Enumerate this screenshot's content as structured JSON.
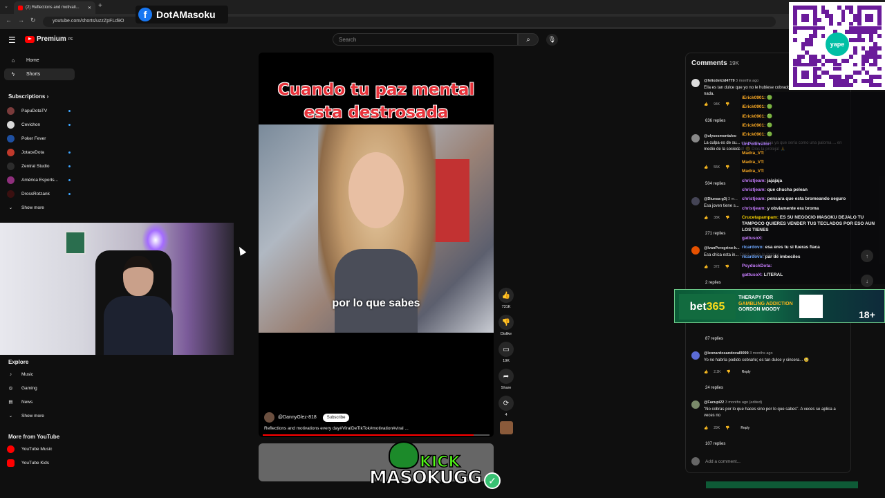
{
  "browser": {
    "tab_title": "(2) Reflections and motivati...",
    "url": "youtube.com/shorts/uzzZpFLd9O"
  },
  "overlay_fb": {
    "text": "DotAMasoku"
  },
  "header": {
    "logo": "Premium",
    "logo_sup": "PE",
    "search_placeholder": "Search"
  },
  "sidebar": {
    "home": "Home",
    "shorts": "Shorts",
    "subscriptions_title": "Subscriptions",
    "subs": [
      {
        "name": "PapuDotaTV",
        "color": "#7a3b3b"
      },
      {
        "name": "Cevichon",
        "color": "#d8d8d8"
      },
      {
        "name": "Poker Fever",
        "color": "#1e4fa0"
      },
      {
        "name": "JotaceDota",
        "color": "#c0392b"
      },
      {
        "name": "Zentral Studio",
        "color": "#2c2c2c"
      },
      {
        "name": "América Esports...",
        "color": "#8e2f7c"
      },
      {
        "name": "DrossRotzank",
        "color": "#3a1010"
      }
    ],
    "show_more": "Show more",
    "explore_title": "Explore",
    "explore": [
      "Music",
      "Gaming",
      "News"
    ],
    "explore_show_more": "Show more",
    "more_title": "More from YouTube",
    "more": [
      "YouTube Music",
      "YouTube Kids"
    ]
  },
  "video": {
    "title_line1": "Cuando tu paz mental",
    "title_line2": "esta destrosada",
    "caption": "por lo que sabes",
    "channel": "@DannyGlez-818",
    "subscribe": "Subscribe",
    "description": "Reflections and motivations every day#ViralDeTikTok#motivation#viral ...",
    "progress": 0.93
  },
  "actions": {
    "likes": "731K",
    "dislike": "Dislike",
    "comments": "19K",
    "share": "Share",
    "remix": "4"
  },
  "comments": {
    "title": "Comments",
    "count": "19K",
    "items": [
      {
        "user": "@felixdelcid4779",
        "time": "3 months ago",
        "text": "Ella es tan dulce que yo no le hubiese cobrado, a veces ayudar no cuesta nada.",
        "likes": "94K",
        "replies": "636 replies"
      },
      {
        "user": "@ulysesmontalvo",
        "time": "",
        "text": "La culpa es de su... enseñarle malicia ya que sería como una paloma ... en medio de la sociedad! 😢 Dios la proteja! 🙏",
        "likes": "55K",
        "replies": "504 replies"
      },
      {
        "user": "@Diunsa-g3j",
        "time": "3 m...",
        "text": "Esa joven tiene s...",
        "likes": "38K",
        "replies": "271 replies"
      },
      {
        "user": "@IvanPeregrino-k...",
        "time": "",
        "text": "Esa chica esta in... Ojalá nadie la lastime",
        "likes": "372",
        "replies": "2 replies"
      },
      {
        "user": "",
        "time": "",
        "text": "",
        "likes": "",
        "replies": "87 replies"
      },
      {
        "user": "@leonardosandoval9099",
        "time": "3 months ago",
        "text": "Yo no habría podido cobrarle; es tan dulce y sincera... 🥹",
        "likes": "2.2K",
        "replies": "24 replies"
      },
      {
        "user": "@Facupi22",
        "time": "3 months ago (edited)",
        "text": "\"No cobras por lo que haces sino por lo que sabes\". A veces se aplica a veces no",
        "likes": "29K",
        "replies": "107 replies"
      }
    ],
    "reply": "Reply",
    "add_placeholder": "Add a comment..."
  },
  "chat": [
    {
      "name": "iErick0901:",
      "msg": "🟢",
      "color": "#f5a623"
    },
    {
      "name": "iErick0901:",
      "msg": "🟢",
      "color": "#f5a623"
    },
    {
      "name": "iErick0901:",
      "msg": "🟢",
      "color": "#f5a623"
    },
    {
      "name": "iErick0901:",
      "msg": "🟢",
      "color": "#f5a623"
    },
    {
      "name": "iErick0901:",
      "msg": "🟢",
      "color": "#f5a623"
    },
    {
      "name": "UnPollinsitor:",
      "msg": "",
      "color": "#b07cff"
    },
    {
      "name": "Madra_VT:",
      "msg": "",
      "color": "#f5a623"
    },
    {
      "name": "Madra_VT:",
      "msg": "",
      "color": "#f5a623"
    },
    {
      "name": "Madra_VT:",
      "msg": "",
      "color": "#f5a623"
    },
    {
      "name": "christjeam:",
      "msg": "jajajaja",
      "color": "#c77dff"
    },
    {
      "name": "christjeam:",
      "msg": "que chucha pelean",
      "color": "#c77dff"
    },
    {
      "name": "christjeam:",
      "msg": "pensara que esta bromeando seguro",
      "color": "#c77dff"
    },
    {
      "name": "christjeam:",
      "msg": "y obviamente era broma",
      "color": "#c77dff"
    },
    {
      "name": "Crucetapampam:",
      "msg": "ES SU NEGOCIO MASOKU DEJALO TU TAMPOCO QUIERES VENDER TUS TECLADOS POR ESO AUN LOS TIENES",
      "color": "#f5d000"
    },
    {
      "name": "gattusoX:",
      "msg": "",
      "color": "#c77dff"
    },
    {
      "name": "ricardovo:",
      "msg": "esa eres tu si fueras flaca",
      "color": "#6ea8ff"
    },
    {
      "name": "ricardovo:",
      "msg": "par de imbeciles",
      "color": "#6ea8ff"
    },
    {
      "name": "PsyduckDota:",
      "msg": "",
      "color": "#c77dff"
    },
    {
      "name": "gattusoX:",
      "msg": "LITERAL",
      "color": "#c77dff"
    }
  ],
  "bet": {
    "logo_a": "bet",
    "logo_b": "365",
    "line1": "THERAPY FOR",
    "line2": "GAMBLING ADDICTION",
    "line3": "GORDON MOODY",
    "age": "18+"
  },
  "kick": {
    "word1": "KICK",
    "word2": "MASOKUGG"
  },
  "colors": {
    "youtube_red": "#ff0000",
    "accent_blue": "#3ea6ff",
    "kick_green": "#53fc18"
  }
}
